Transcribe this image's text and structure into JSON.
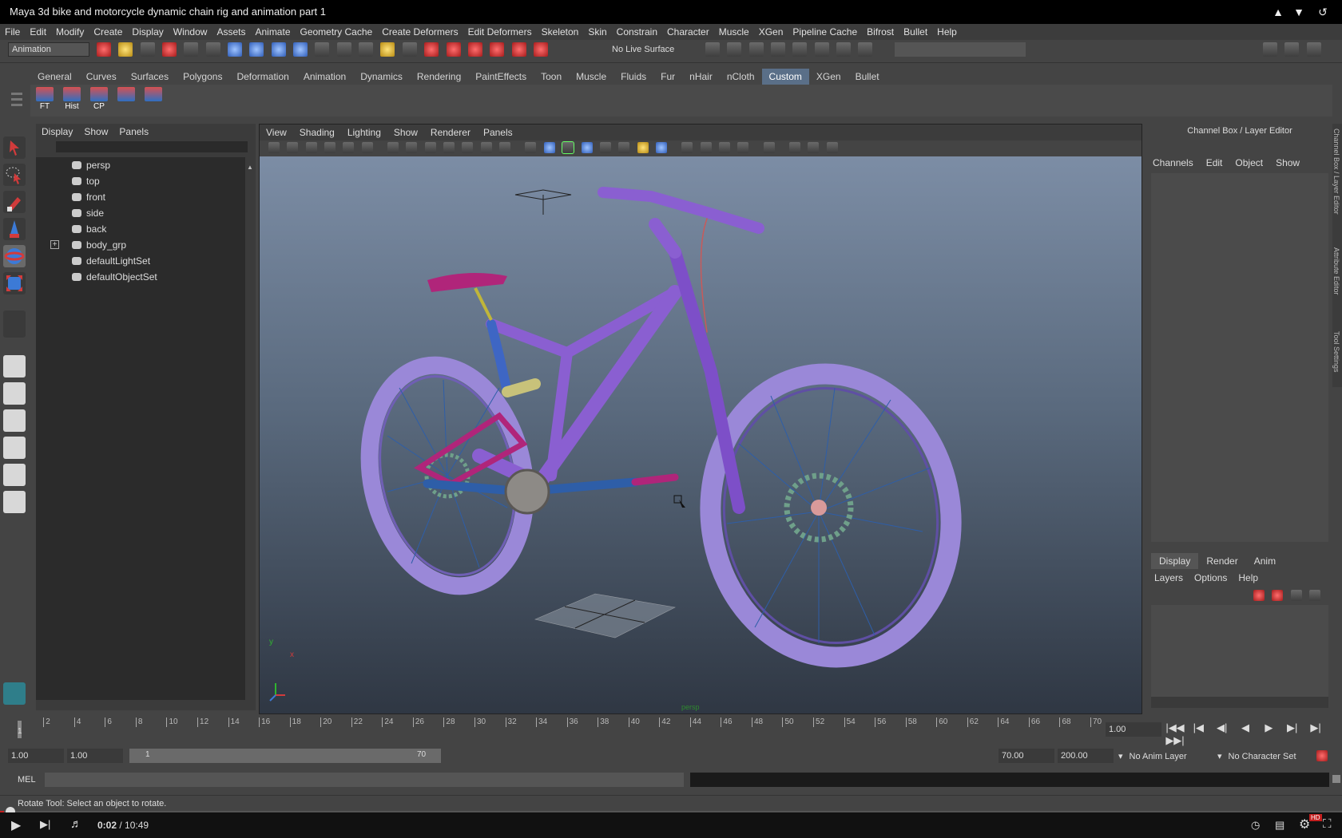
{
  "video": {
    "title": "Maya 3d bike and motorcycle dynamic chain rig and animation part 1",
    "current_time": "0:02",
    "duration": "10:49",
    "time_display": "0:02 / 10:49",
    "progress_fraction": 0.003,
    "hd_badge": "HD"
  },
  "menubar": [
    "File",
    "Edit",
    "Modify",
    "Create",
    "Display",
    "Window",
    "Assets",
    "Animate",
    "Geometry Cache",
    "Create Deformers",
    "Edit Deformers",
    "Skeleton",
    "Skin",
    "Constrain",
    "Character",
    "Muscle",
    "XGen",
    "Pipeline Cache",
    "Bifrost",
    "Bullet",
    "Help"
  ],
  "statusline": {
    "mode": "Animation",
    "live_surface": "No Live Surface"
  },
  "shelf": {
    "tabs": [
      "General",
      "Curves",
      "Surfaces",
      "Polygons",
      "Deformation",
      "Animation",
      "Dynamics",
      "Rendering",
      "PaintEffects",
      "Toon",
      "Muscle",
      "Fluids",
      "Fur",
      "nHair",
      "nCloth",
      "Custom",
      "XGen",
      "Bullet"
    ],
    "active_tab": "Custom",
    "buttons": [
      "FT",
      "Hist",
      "CP",
      "",
      ""
    ]
  },
  "outliner": {
    "menu": [
      "Display",
      "Show",
      "Panels"
    ],
    "items": [
      {
        "label": "persp",
        "expandable": false
      },
      {
        "label": "top",
        "expandable": false
      },
      {
        "label": "front",
        "expandable": false
      },
      {
        "label": "side",
        "expandable": false
      },
      {
        "label": "back",
        "expandable": false
      },
      {
        "label": "body_grp",
        "expandable": true
      },
      {
        "label": "defaultLightSet",
        "expandable": false
      },
      {
        "label": "defaultObjectSet",
        "expandable": false
      }
    ]
  },
  "viewport": {
    "menu": [
      "View",
      "Shading",
      "Lighting",
      "Show",
      "Renderer",
      "Panels"
    ],
    "camera_label": "persp",
    "axis_labels": {
      "y": "y",
      "x": "x"
    }
  },
  "channelbox": {
    "title": "Channel Box / Layer Editor",
    "menu": [
      "Channels",
      "Edit",
      "Object",
      "Show"
    ],
    "layer_tabs": [
      "Display",
      "Render",
      "Anim"
    ],
    "active_layer_tab": "Display",
    "layer_menu": [
      "Layers",
      "Options",
      "Help"
    ],
    "side_tabs": [
      "Channel Box / Layer Editor",
      "Attribute Editor",
      "Tool Settings"
    ]
  },
  "timeline": {
    "ticks": [
      2,
      4,
      6,
      8,
      10,
      12,
      14,
      16,
      18,
      20,
      22,
      24,
      26,
      28,
      30,
      32,
      34,
      36,
      38,
      40,
      42,
      44,
      46,
      48,
      50,
      52,
      54,
      56,
      58,
      60,
      62,
      64,
      66,
      68,
      70
    ],
    "current_frame": "1",
    "current_frame_field": "1.00"
  },
  "range": {
    "start_time": "1.00",
    "playback_start": "1.00",
    "range_handle_start": "1",
    "range_handle_end": "70",
    "playback_end": "70.00",
    "end_time": "200.00",
    "anim_layer": "No Anim Layer",
    "character_set": "No Character Set"
  },
  "commandline": {
    "label": "MEL"
  },
  "helpline": {
    "text": "Rotate Tool: Select an object to rotate."
  },
  "colors": {
    "bike_purple": "#8a5fd1",
    "seat_magenta": "#b0257a",
    "active_tab": "#5a6f88",
    "progress_red": "#c41f1f"
  }
}
